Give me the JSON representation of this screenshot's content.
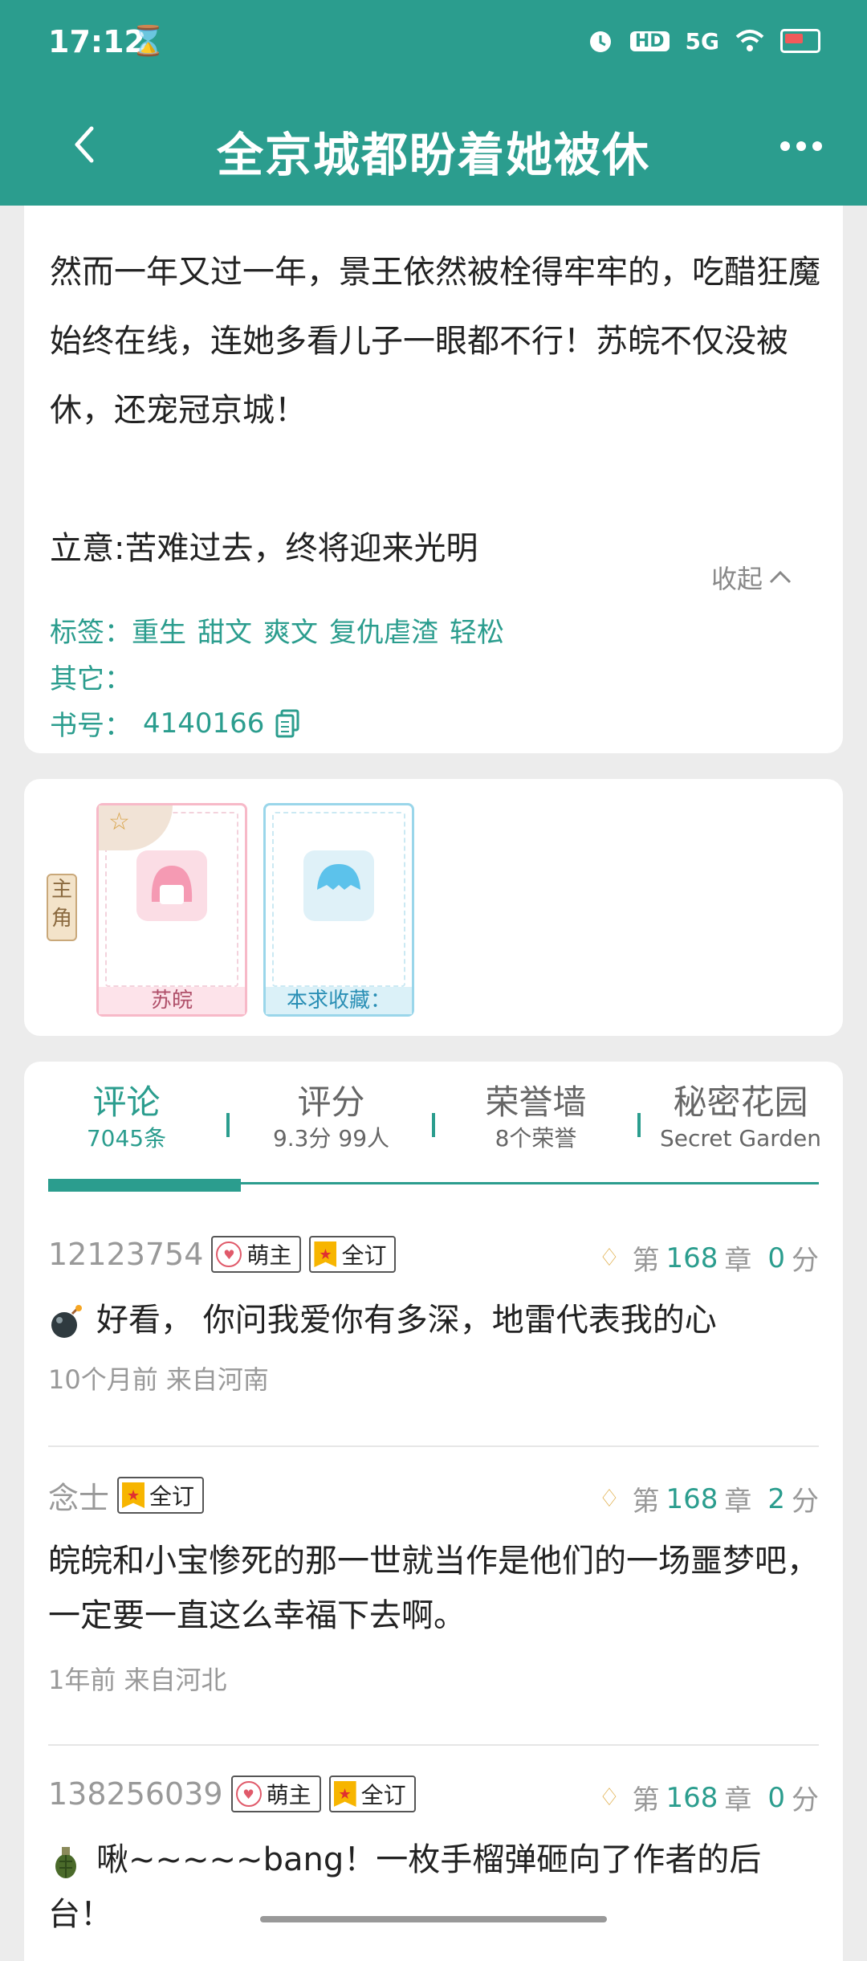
{
  "status_bar": {
    "time": "17:12",
    "hourglass": "⌛",
    "hd": "HD",
    "network": "5G"
  },
  "header": {
    "title": "全京城都盼着她被休"
  },
  "intro": {
    "paragraph1": "然而一年又过一年，景王依然被栓得牢牢的，吃醋狂魔始终在线，连她多看儿子一眼都不行！苏皖不仅没被休，还宠冠京城！",
    "paragraph2": "立意:苦难过去，终将迎来光明",
    "collapse_label": "收起"
  },
  "meta": {
    "tags_label": "标签：",
    "tags": [
      "重生",
      "甜文",
      "爽文",
      "复仇虐渣",
      "轻松"
    ],
    "other_label": "其它：",
    "bookid_label": "书号：",
    "bookid_value": "4140166"
  },
  "characters": {
    "role_label_top": "主",
    "role_label_bottom": "角",
    "items": [
      {
        "name": "苏皖",
        "star": "☆"
      },
      {
        "name": "本求收藏："
      }
    ]
  },
  "tabs": [
    {
      "title": "评论",
      "sub": "7045条"
    },
    {
      "title": "评分",
      "sub": "9.3分 99人"
    },
    {
      "title": "荣誉墙",
      "sub": "8个荣誉"
    },
    {
      "title": "秘密花园",
      "sub": "Secret Garden"
    }
  ],
  "comments": [
    {
      "user": "12123754",
      "badges": [
        "萌主",
        "全订"
      ],
      "chapter_prefix": "第",
      "chapter": "168",
      "chapter_suffix": "章",
      "score": "0",
      "score_suffix": "分",
      "icon": "bomb-icon",
      "body": "好看，  你问我爱你有多深，地雷代表我的心",
      "time": "10个月前  来自河南"
    },
    {
      "user": "念士",
      "badges": [
        "全订"
      ],
      "chapter_prefix": "第",
      "chapter": "168",
      "chapter_suffix": "章",
      "score": "2",
      "score_suffix": "分",
      "body": "皖皖和小宝惨死的那一世就当作是他们的一场噩梦吧，一定要一直这么幸福下去啊。",
      "time": "1年前  来自河北"
    },
    {
      "user": "138256039",
      "badges": [
        "萌主",
        "全订"
      ],
      "chapter_prefix": "第",
      "chapter": "168",
      "chapter_suffix": "章",
      "score": "0",
      "score_suffix": "分",
      "icon": "grenade-icon",
      "body": "啾~~~~~bang！一枚手榴弹砸向了作者的后台！"
    }
  ],
  "colors": {
    "accent": "#2b9d8e",
    "muted": "#999999"
  }
}
